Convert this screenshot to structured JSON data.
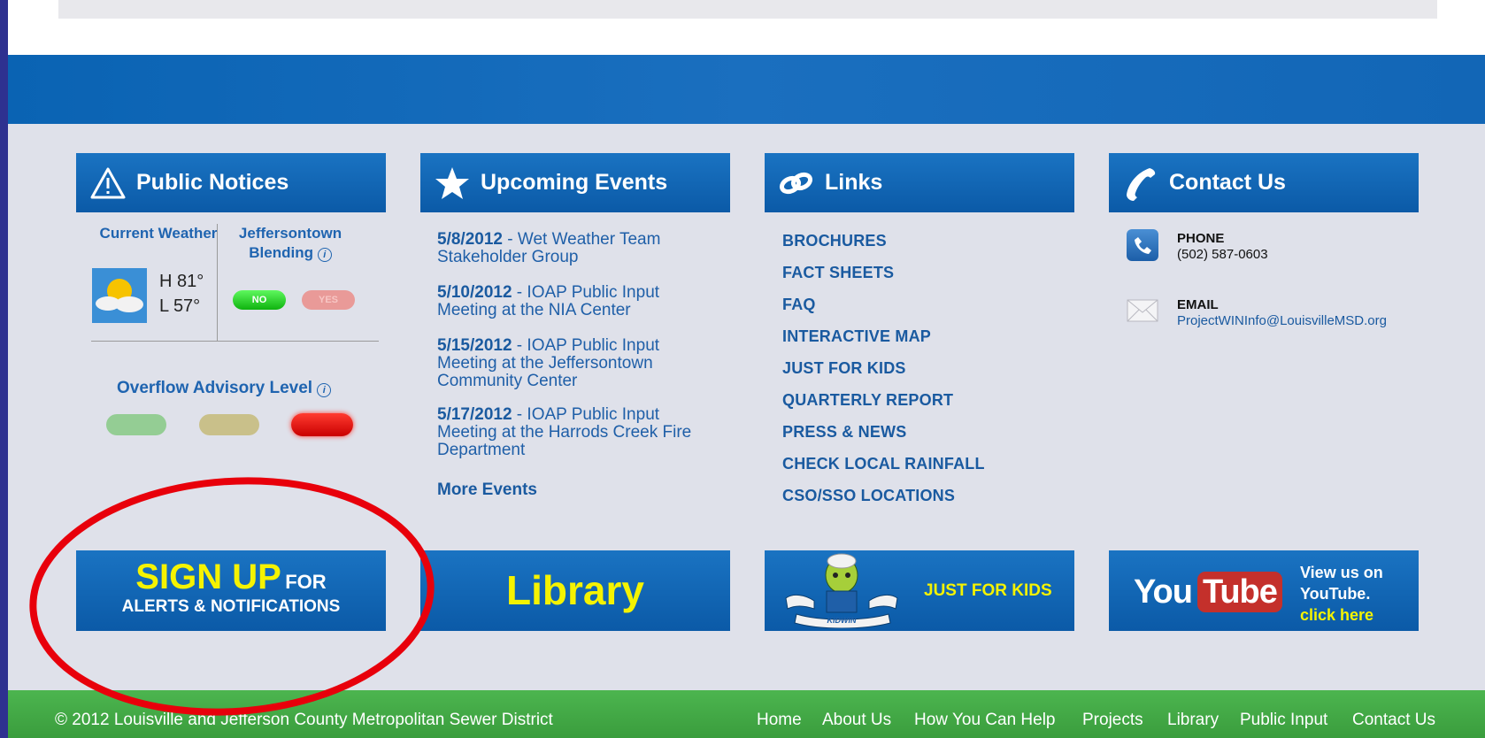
{
  "public_notices": {
    "title": "Public Notices",
    "weather_label": "Current Weather",
    "weather_high": "H 81°",
    "weather_low": "L 57°",
    "blending_label": "Jeffersontown Blending",
    "blending_no": "NO",
    "blending_yes": "YES",
    "overflow_label": "Overflow Advisory Level",
    "overflow_active_level": "red"
  },
  "events": {
    "title": "Upcoming Events",
    "items": [
      {
        "date": "5/8/2012",
        "text": " - Wet Weather Team Stakeholder Group"
      },
      {
        "date": "5/10/2012",
        "text": " - IOAP Public Input Meeting at the NIA Center"
      },
      {
        "date": "5/15/2012",
        "text": " - IOAP Public Input Meeting at the Jeffersontown Community Center"
      },
      {
        "date": "5/17/2012",
        "text": " - IOAP Public Input Meeting at the Harrods Creek Fire Department"
      }
    ],
    "more": "More Events"
  },
  "links": {
    "title": "Links",
    "items": [
      "BROCHURES",
      "FACT SHEETS",
      "FAQ",
      "INTERACTIVE MAP",
      "JUST FOR KIDS",
      "QUARTERLY REPORT",
      "PRESS & NEWS",
      "CHECK LOCAL RAINFALL",
      "CSO/SSO LOCATIONS"
    ]
  },
  "contact": {
    "title": "Contact Us",
    "phone_label": "PHONE",
    "phone_value": "(502) 587-0603",
    "email_label": "EMAIL",
    "email_value": "ProjectWINInfo@LouisvilleMSD.org"
  },
  "banners": {
    "signup_big": "SIGN UP",
    "signup_for": "FOR",
    "signup_sub": "ALERTS & NOTIFICATIONS",
    "library": "Library",
    "kids": "JUST FOR KIDS",
    "kids_badge": "KIDWIN",
    "youtube_you": "You",
    "youtube_tube": "Tube",
    "youtube_line1": "View us on",
    "youtube_line2": "YouTube.",
    "youtube_line3": "click here"
  },
  "footer": {
    "copyright": "© 2012 Louisville and Jefferson County Metropolitan Sewer District",
    "nav": [
      "Home",
      "About Us",
      "How You Can Help",
      "Projects",
      "Library",
      "Public Input",
      "Contact Us"
    ]
  },
  "colors": {
    "panel_blue": "#0b5aa7",
    "footer_green": "#3a9d3d",
    "annotation_red": "#e8000b",
    "highlight_yellow": "#f5f300"
  }
}
